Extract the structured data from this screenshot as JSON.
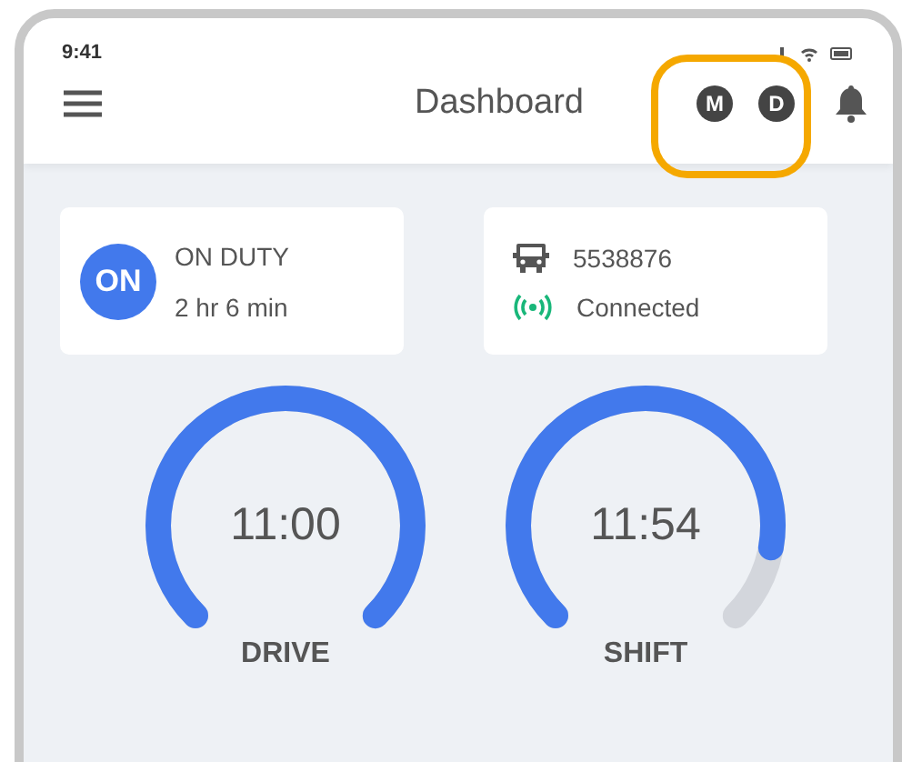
{
  "status_bar": {
    "time": "9:41"
  },
  "header": {
    "title": "Dashboard",
    "avatars": [
      "M",
      "D"
    ]
  },
  "duty_card": {
    "badge": "ON",
    "status": "ON DUTY",
    "duration": "2 hr 6 min"
  },
  "vehicle_card": {
    "number": "5538876",
    "connection": "Connected"
  },
  "gauges": [
    {
      "time": "11:00",
      "label": "DRIVE",
      "level": 1
    },
    {
      "time": "11:54",
      "label": "SHIFT",
      "level": 0.87
    }
  ]
}
